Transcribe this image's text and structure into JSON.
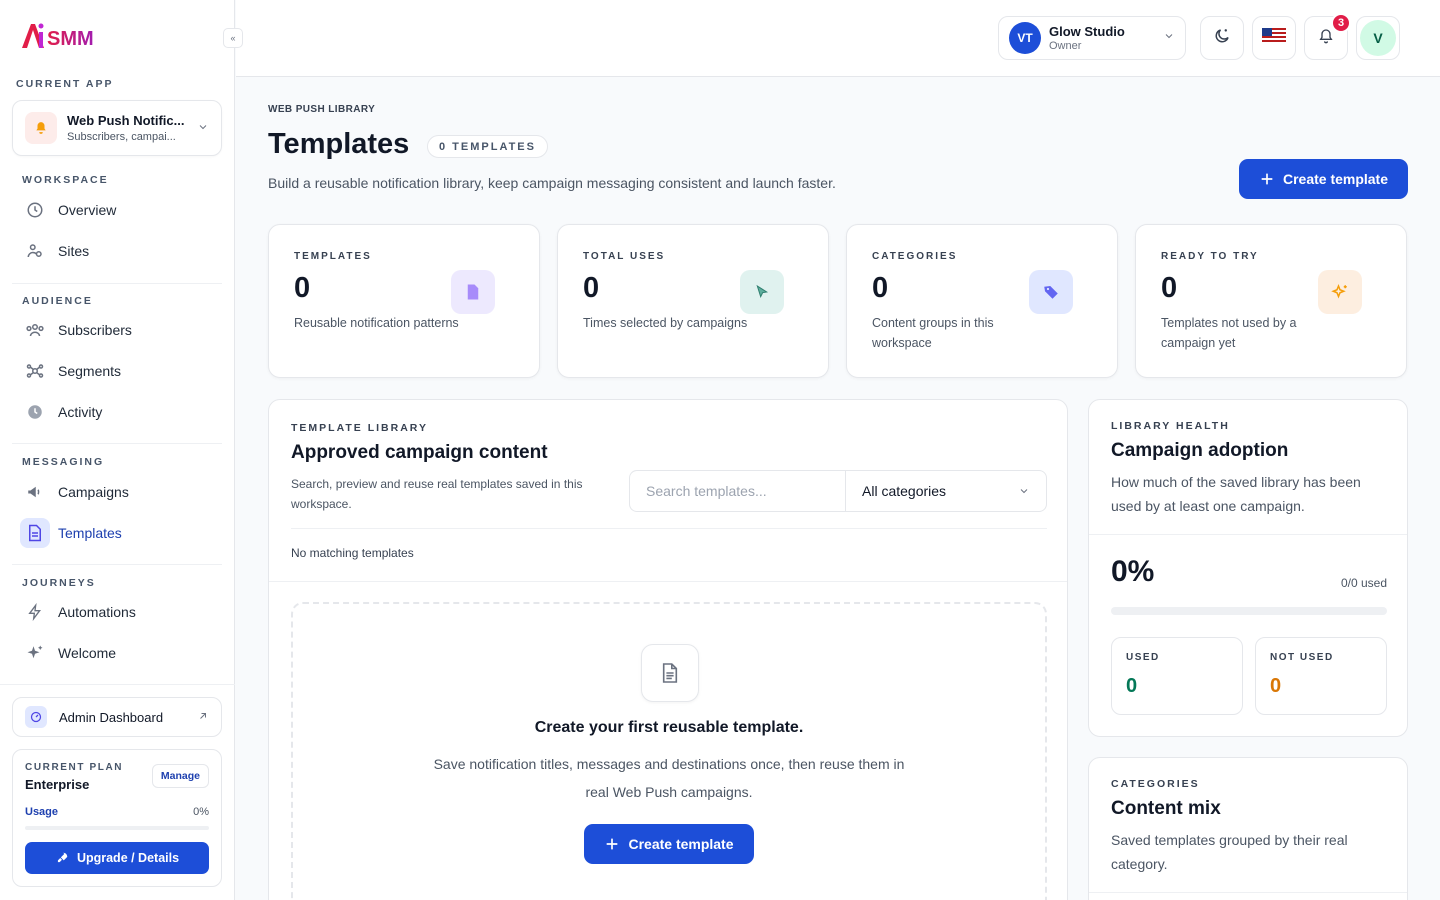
{
  "brand": {
    "name": "AiSMM"
  },
  "sidebar": {
    "current_app_label": "CURRENT APP",
    "app": {
      "title": "Web Push Notific...",
      "subtitle": "Subscribers, campai..."
    },
    "sections": {
      "workspace": "WORKSPACE",
      "audience": "AUDIENCE",
      "messaging": "MESSAGING",
      "journeys": "JOURNEYS"
    },
    "items": {
      "overview": "Overview",
      "sites": "Sites",
      "subscribers": "Subscribers",
      "segments": "Segments",
      "activity": "Activity",
      "campaigns": "Campaigns",
      "templates": "Templates",
      "automations": "Automations",
      "welcome": "Welcome"
    },
    "admin_dashboard": "Admin Dashboard",
    "plan": {
      "label": "CURRENT PLAN",
      "name": "Enterprise",
      "manage": "Manage",
      "usage_label": "Usage",
      "usage_value": "0%",
      "upgrade": "Upgrade / Details"
    }
  },
  "topbar": {
    "org": {
      "initials": "VT",
      "name": "Glow Studio",
      "role": "Owner"
    },
    "notifications_count": "3",
    "user_initial": "V"
  },
  "page": {
    "eyebrow": "WEB PUSH LIBRARY",
    "title": "Templates",
    "count_pill": "0 TEMPLATES",
    "subtitle": "Build a reusable notification library, keep campaign messaging consistent and launch faster.",
    "create_button": "Create template"
  },
  "stats": [
    {
      "label": "TEMPLATES",
      "value": "0",
      "desc": "Reusable notification patterns"
    },
    {
      "label": "TOTAL USES",
      "value": "0",
      "desc": "Times selected by campaigns"
    },
    {
      "label": "CATEGORIES",
      "value": "0",
      "desc": "Content groups in this workspace"
    },
    {
      "label": "READY TO TRY",
      "value": "0",
      "desc": "Templates not used by a campaign yet"
    }
  ],
  "library": {
    "eyebrow": "TEMPLATE LIBRARY",
    "title": "Approved campaign content",
    "desc": "Search, preview and reuse real templates saved in this workspace.",
    "search_placeholder": "Search templates...",
    "category_selected": "All categories",
    "no_match": "No matching templates",
    "empty_title": "Create your first reusable template.",
    "empty_desc": "Save notification titles, messages and destinations once, then reuse them in real Web Push campaigns.",
    "empty_button": "Create template"
  },
  "health": {
    "eyebrow": "LIBRARY HEALTH",
    "title": "Campaign adoption",
    "desc": "How much of the saved library has been used by at least one campaign.",
    "percent": "0%",
    "used_text": "0/0 used",
    "progress": 0,
    "used_label": "USED",
    "used_value": "0",
    "not_used_label": "NOT USED",
    "not_used_value": "0"
  },
  "content_mix": {
    "eyebrow": "CATEGORIES",
    "title": "Content mix",
    "desc": "Saved templates grouped by their real category."
  },
  "colors": {
    "primary": "#1d4ed8",
    "used_green": "#047857",
    "not_used_orange": "#d97706",
    "badge_red": "#e11d48"
  }
}
